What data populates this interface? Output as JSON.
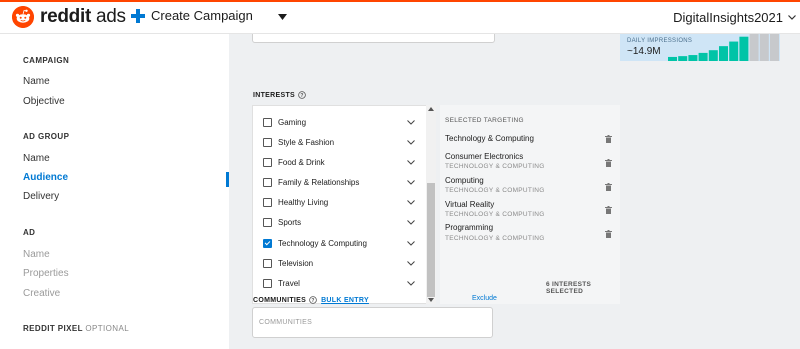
{
  "header": {
    "logo_bold": "reddit",
    "logo_light": "ads",
    "create_label": "Create Campaign",
    "account_name": "DigitalInsights2021",
    "brand_color": "#ff4500"
  },
  "sidebar": {
    "sections": [
      {
        "heading": "CAMPAIGN",
        "items": [
          "Name",
          "Objective"
        ]
      },
      {
        "heading": "AD GROUP",
        "items": [
          "Name",
          "Audience",
          "Delivery"
        ],
        "active": "Audience"
      },
      {
        "heading": "AD",
        "items": [
          "Name",
          "Properties",
          "Creative"
        ],
        "disabled": true
      },
      {
        "heading": "REDDIT PIXEL",
        "optional_note": "OPTIONAL",
        "items": []
      }
    ]
  },
  "interests": {
    "label": "INTERESTS",
    "options": [
      {
        "label": "Gaming",
        "checked": false
      },
      {
        "label": "Style & Fashion",
        "checked": false
      },
      {
        "label": "Food & Drink",
        "checked": false
      },
      {
        "label": "Family & Relationships",
        "checked": false
      },
      {
        "label": "Healthy Living",
        "checked": false
      },
      {
        "label": "Sports",
        "checked": false
      },
      {
        "label": "Technology & Computing",
        "checked": true
      },
      {
        "label": "Television",
        "checked": false
      },
      {
        "label": "Travel",
        "checked": false
      }
    ],
    "selected_heading": "SELECTED TARGETING",
    "selected_group": "Technology & Computing",
    "selected": [
      {
        "name": "Consumer Electronics",
        "category": "TECHNOLOGY & COMPUTING"
      },
      {
        "name": "Computing",
        "category": "TECHNOLOGY & COMPUTING"
      },
      {
        "name": "Virtual Reality",
        "category": "TECHNOLOGY & COMPUTING"
      },
      {
        "name": "Programming",
        "category": "TECHNOLOGY & COMPUTING"
      }
    ],
    "selected_count_text": "6 INTERESTS SELECTED"
  },
  "communities": {
    "label": "COMMUNITIES",
    "bulk_entry": "BULK ENTRY",
    "exclude": "Exclude",
    "placeholder": "COMMUNITIES"
  },
  "impressions": {
    "label": "DAILY IMPRESSIONS",
    "value": "~14.9M",
    "accent_color": "#00c4a7",
    "chart_data": {
      "type": "bar",
      "bar_count": 11,
      "highlighted_bars": 8,
      "relative_values": [
        0.15,
        0.18,
        0.22,
        0.3,
        0.4,
        0.55,
        0.72,
        0.9,
        1.0,
        1.0,
        1.0
      ]
    }
  }
}
